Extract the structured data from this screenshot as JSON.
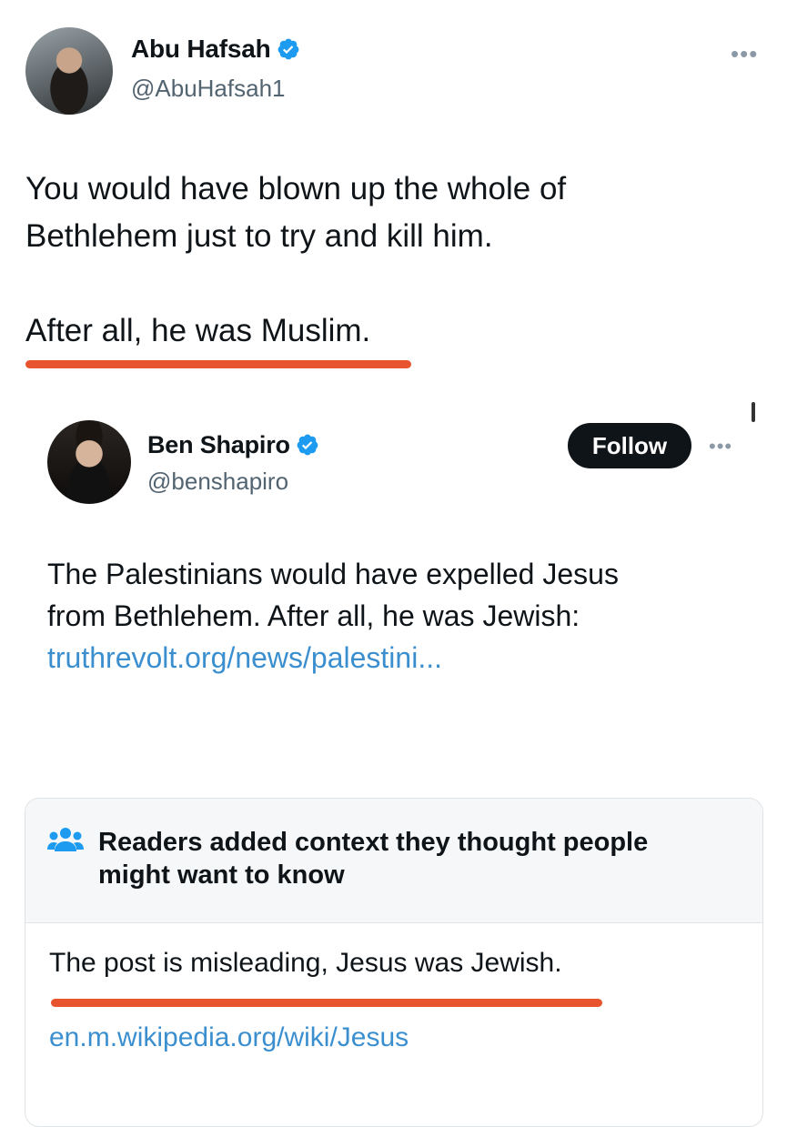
{
  "tweet": {
    "author_name": "Abu Hafsah",
    "author_handle": "@AbuHafsah1",
    "more_icon": "more-dots-icon",
    "text_line1": "You would have blown up the whole of",
    "text_line2": "Bethlehem just to try and kill him.",
    "text_line3": "After all, he was Muslim."
  },
  "quoted": {
    "author_name": "Ben Shapiro",
    "author_handle": "@benshapiro",
    "follow_label": "Follow",
    "text_line1": "The Palestinians would have expelled Jesus",
    "text_line2": "from Bethlehem. After all, he was Jewish:",
    "link": "truthrevolt.org/news/palestini..."
  },
  "community_note": {
    "icon": "people-icon",
    "title_line1": "Readers added context they thought people",
    "title_line2": "might want to know",
    "body": "The post is misleading, Jesus was Jewish.",
    "link": "en.m.wikipedia.org/wiki/Jesus"
  },
  "colors": {
    "verified": "#1d9bf0",
    "highlight": "#e8542d",
    "link": "#3b8fcf"
  }
}
